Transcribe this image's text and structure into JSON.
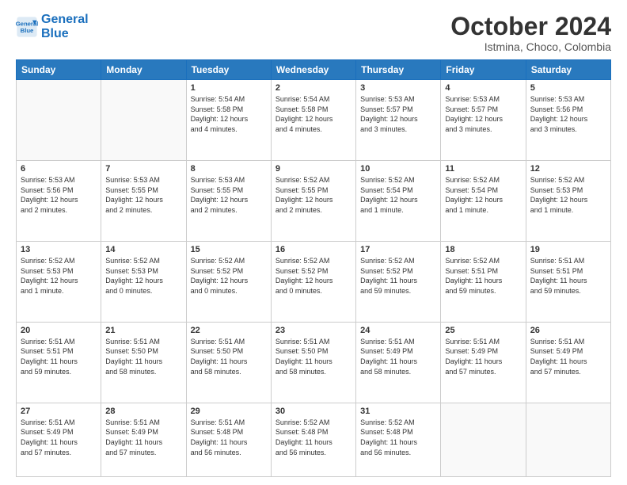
{
  "logo": {
    "line1": "General",
    "line2": "Blue"
  },
  "title": "October 2024",
  "location": "Istmina, Choco, Colombia",
  "header_days": [
    "Sunday",
    "Monday",
    "Tuesday",
    "Wednesday",
    "Thursday",
    "Friday",
    "Saturday"
  ],
  "weeks": [
    [
      {
        "day": "",
        "info": ""
      },
      {
        "day": "",
        "info": ""
      },
      {
        "day": "1",
        "info": "Sunrise: 5:54 AM\nSunset: 5:58 PM\nDaylight: 12 hours\nand 4 minutes."
      },
      {
        "day": "2",
        "info": "Sunrise: 5:54 AM\nSunset: 5:58 PM\nDaylight: 12 hours\nand 4 minutes."
      },
      {
        "day": "3",
        "info": "Sunrise: 5:53 AM\nSunset: 5:57 PM\nDaylight: 12 hours\nand 3 minutes."
      },
      {
        "day": "4",
        "info": "Sunrise: 5:53 AM\nSunset: 5:57 PM\nDaylight: 12 hours\nand 3 minutes."
      },
      {
        "day": "5",
        "info": "Sunrise: 5:53 AM\nSunset: 5:56 PM\nDaylight: 12 hours\nand 3 minutes."
      }
    ],
    [
      {
        "day": "6",
        "info": "Sunrise: 5:53 AM\nSunset: 5:56 PM\nDaylight: 12 hours\nand 2 minutes."
      },
      {
        "day": "7",
        "info": "Sunrise: 5:53 AM\nSunset: 5:55 PM\nDaylight: 12 hours\nand 2 minutes."
      },
      {
        "day": "8",
        "info": "Sunrise: 5:53 AM\nSunset: 5:55 PM\nDaylight: 12 hours\nand 2 minutes."
      },
      {
        "day": "9",
        "info": "Sunrise: 5:52 AM\nSunset: 5:55 PM\nDaylight: 12 hours\nand 2 minutes."
      },
      {
        "day": "10",
        "info": "Sunrise: 5:52 AM\nSunset: 5:54 PM\nDaylight: 12 hours\nand 1 minute."
      },
      {
        "day": "11",
        "info": "Sunrise: 5:52 AM\nSunset: 5:54 PM\nDaylight: 12 hours\nand 1 minute."
      },
      {
        "day": "12",
        "info": "Sunrise: 5:52 AM\nSunset: 5:53 PM\nDaylight: 12 hours\nand 1 minute."
      }
    ],
    [
      {
        "day": "13",
        "info": "Sunrise: 5:52 AM\nSunset: 5:53 PM\nDaylight: 12 hours\nand 1 minute."
      },
      {
        "day": "14",
        "info": "Sunrise: 5:52 AM\nSunset: 5:53 PM\nDaylight: 12 hours\nand 0 minutes."
      },
      {
        "day": "15",
        "info": "Sunrise: 5:52 AM\nSunset: 5:52 PM\nDaylight: 12 hours\nand 0 minutes."
      },
      {
        "day": "16",
        "info": "Sunrise: 5:52 AM\nSunset: 5:52 PM\nDaylight: 12 hours\nand 0 minutes."
      },
      {
        "day": "17",
        "info": "Sunrise: 5:52 AM\nSunset: 5:52 PM\nDaylight: 11 hours\nand 59 minutes."
      },
      {
        "day": "18",
        "info": "Sunrise: 5:52 AM\nSunset: 5:51 PM\nDaylight: 11 hours\nand 59 minutes."
      },
      {
        "day": "19",
        "info": "Sunrise: 5:51 AM\nSunset: 5:51 PM\nDaylight: 11 hours\nand 59 minutes."
      }
    ],
    [
      {
        "day": "20",
        "info": "Sunrise: 5:51 AM\nSunset: 5:51 PM\nDaylight: 11 hours\nand 59 minutes."
      },
      {
        "day": "21",
        "info": "Sunrise: 5:51 AM\nSunset: 5:50 PM\nDaylight: 11 hours\nand 58 minutes."
      },
      {
        "day": "22",
        "info": "Sunrise: 5:51 AM\nSunset: 5:50 PM\nDaylight: 11 hours\nand 58 minutes."
      },
      {
        "day": "23",
        "info": "Sunrise: 5:51 AM\nSunset: 5:50 PM\nDaylight: 11 hours\nand 58 minutes."
      },
      {
        "day": "24",
        "info": "Sunrise: 5:51 AM\nSunset: 5:49 PM\nDaylight: 11 hours\nand 58 minutes."
      },
      {
        "day": "25",
        "info": "Sunrise: 5:51 AM\nSunset: 5:49 PM\nDaylight: 11 hours\nand 57 minutes."
      },
      {
        "day": "26",
        "info": "Sunrise: 5:51 AM\nSunset: 5:49 PM\nDaylight: 11 hours\nand 57 minutes."
      }
    ],
    [
      {
        "day": "27",
        "info": "Sunrise: 5:51 AM\nSunset: 5:49 PM\nDaylight: 11 hours\nand 57 minutes."
      },
      {
        "day": "28",
        "info": "Sunrise: 5:51 AM\nSunset: 5:49 PM\nDaylight: 11 hours\nand 57 minutes."
      },
      {
        "day": "29",
        "info": "Sunrise: 5:51 AM\nSunset: 5:48 PM\nDaylight: 11 hours\nand 56 minutes."
      },
      {
        "day": "30",
        "info": "Sunrise: 5:52 AM\nSunset: 5:48 PM\nDaylight: 11 hours\nand 56 minutes."
      },
      {
        "day": "31",
        "info": "Sunrise: 5:52 AM\nSunset: 5:48 PM\nDaylight: 11 hours\nand 56 minutes."
      },
      {
        "day": "",
        "info": ""
      },
      {
        "day": "",
        "info": ""
      }
    ]
  ]
}
